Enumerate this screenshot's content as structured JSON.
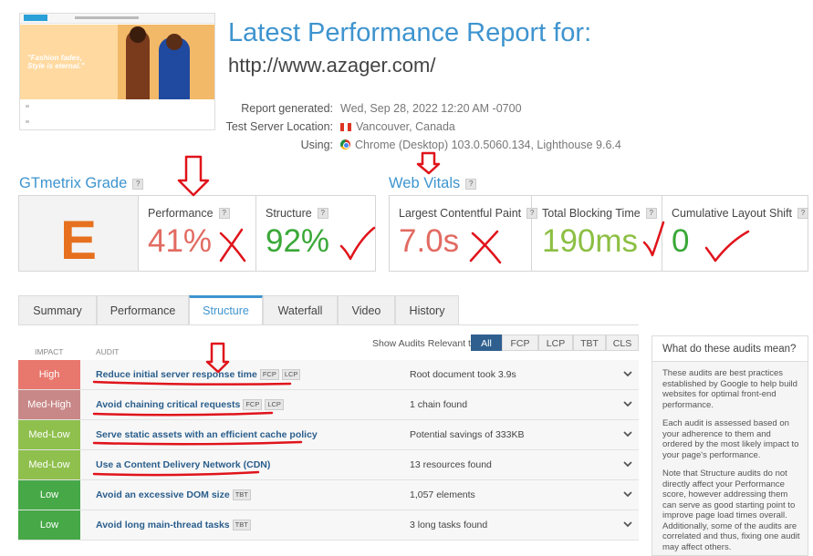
{
  "header": {
    "title": "Latest Performance Report for:",
    "url": "http://www.azager.com/",
    "thumbnail_slogan_1": "\"Fashion fades,",
    "thumbnail_slogan_2": "Style is eternal.\"",
    "meta": [
      {
        "label": "Report generated:",
        "value": "Wed, Sep 28, 2022 12:20 AM -0700"
      },
      {
        "label": "Test Server Location:",
        "value": "Vancouver, Canada"
      },
      {
        "label": "Using:",
        "value": "Chrome (Desktop) 103.0.5060.134, Lighthouse 9.6.4"
      }
    ]
  },
  "gtmetrix": {
    "title": "GTmetrix Grade",
    "help": "?",
    "grade": "E",
    "performance_label": "Performance",
    "performance_value": "41%",
    "structure_label": "Structure",
    "structure_value": "92%"
  },
  "webvitals": {
    "title": "Web Vitals",
    "help": "?",
    "lcp_label": "Largest Contentful Paint",
    "lcp_value": "7.0s",
    "tbt_label": "Total Blocking Time",
    "tbt_value": "190ms",
    "cls_label": "Cumulative Layout Shift",
    "cls_value": "0"
  },
  "tabs": [
    "Summary",
    "Performance",
    "Structure",
    "Waterfall",
    "Video",
    "History"
  ],
  "active_tab": "Structure",
  "audits": {
    "impact_header": "IMPACT",
    "audit_header": "AUDIT",
    "filter_label": "Show Audits Relevant to",
    "filters": [
      "All",
      "FCP",
      "LCP",
      "TBT",
      "CLS"
    ],
    "active_filter": "All",
    "rows": [
      {
        "impact": "High",
        "color": "#e8776d",
        "name": "Reduce initial server response time",
        "tags": [
          "FCP",
          "LCP"
        ],
        "result": "Root document took 3.9s"
      },
      {
        "impact": "Med-High",
        "color": "#c98888",
        "name": "Avoid chaining critical requests",
        "tags": [
          "FCP",
          "LCP"
        ],
        "result": "1 chain found"
      },
      {
        "impact": "Med-Low",
        "color": "#8fc04e",
        "name": "Serve static assets with an efficient cache policy",
        "tags": [],
        "result": "Potential savings of 333KB"
      },
      {
        "impact": "Med-Low",
        "color": "#8fc04e",
        "name": "Use a Content Delivery Network (CDN)",
        "tags": [],
        "result": "13 resources found"
      },
      {
        "impact": "Low",
        "color": "#46a847",
        "name": "Avoid an excessive DOM size",
        "tags": [
          "TBT"
        ],
        "result": "1,057 elements"
      },
      {
        "impact": "Low",
        "color": "#46a847",
        "name": "Avoid long main-thread tasks",
        "tags": [
          "TBT"
        ],
        "result": "3 long tasks found"
      }
    ]
  },
  "sidebar": {
    "title": "What do these audits mean?",
    "p1": "These audits are best practices established by Google to help build websites for optimal front-end performance.",
    "p2": "Each audit is assessed based on your adherence to them and ordered by the most likely impact to your page's performance.",
    "p3": "Note that Structure audits do not directly affect your Performance score, however addressing them can serve as good starting point to improve page load times overall. Additionally, some of the audits are correlated and thus, fixing one audit may affect others."
  }
}
